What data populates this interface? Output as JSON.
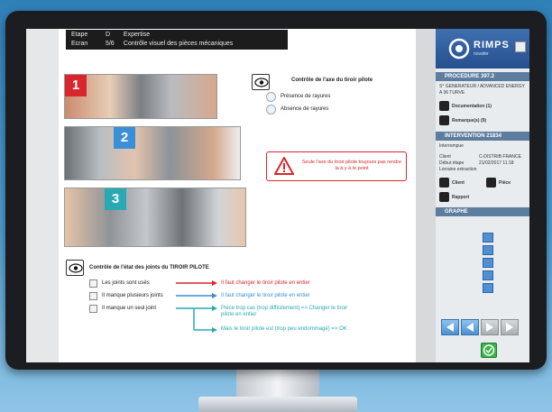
{
  "header": {
    "row1": {
      "col1": "Etape",
      "col2": "D",
      "col3": "Expertise"
    },
    "row2": {
      "col1": "Ecran",
      "col2": "5/6",
      "col3": "Contrôle visuel des pièces mécaniques"
    }
  },
  "photos": [
    {
      "badge": "1",
      "color": "#d9262c"
    },
    {
      "badge": "2",
      "color": "#3b8fd6"
    },
    {
      "badge": "3",
      "color": "#29a9b3"
    }
  ],
  "check1": {
    "title": "Contrôle de l'axe du tiroir pilote",
    "options": [
      "Présence de rayures",
      "Absence de rayures"
    ]
  },
  "warning": {
    "message": "Seule l'axe du tiroir pilote toujours pas rendre la à y à le point"
  },
  "check2": {
    "title": "Contrôle de l'état des joints du TIROIR PILOTE",
    "rows": [
      {
        "label": "Les joints sont usés",
        "action": "Il faut changer le tiroir pilote en entier",
        "color": "#d9262c"
      },
      {
        "label": "Il manque plusieurs joints",
        "action": "Il faut changer le tiroir pilote en entier",
        "color": "#3b8fd6"
      },
      {
        "label": "Il manque un seul joint",
        "action": "Pièce trop cas (trop difficilement) => Changer le tiroir pilote en entier",
        "color": "#29a9b3"
      }
    ],
    "extra": "Mais le tiroir pilote est (trop peu endommagé) => OK"
  },
  "rightPanel": {
    "logoText": "RIMPS",
    "logoSub": "novafer",
    "procedure": {
      "title": "PROCEDURE 397.2",
      "line1": "S° GENERATEUR / ADVANCED ENERGY",
      "line2": "A 36 TURVE"
    },
    "docButton": "Documentation (1)",
    "remarksButton": "Remarque(s) (9)",
    "intervention": {
      "title": "INTERVENTION 21834",
      "status": "Interrompue",
      "label1": "Client",
      "value1": "C-DISTRIB FRANCE",
      "label2": "Début étape",
      "value2": "21/02/2017 11:18",
      "label3": "Lorraine extraction"
    },
    "actions": [
      "Client",
      "Pièce",
      "Rapport"
    ],
    "grapheTitle": "GRAPHE"
  }
}
